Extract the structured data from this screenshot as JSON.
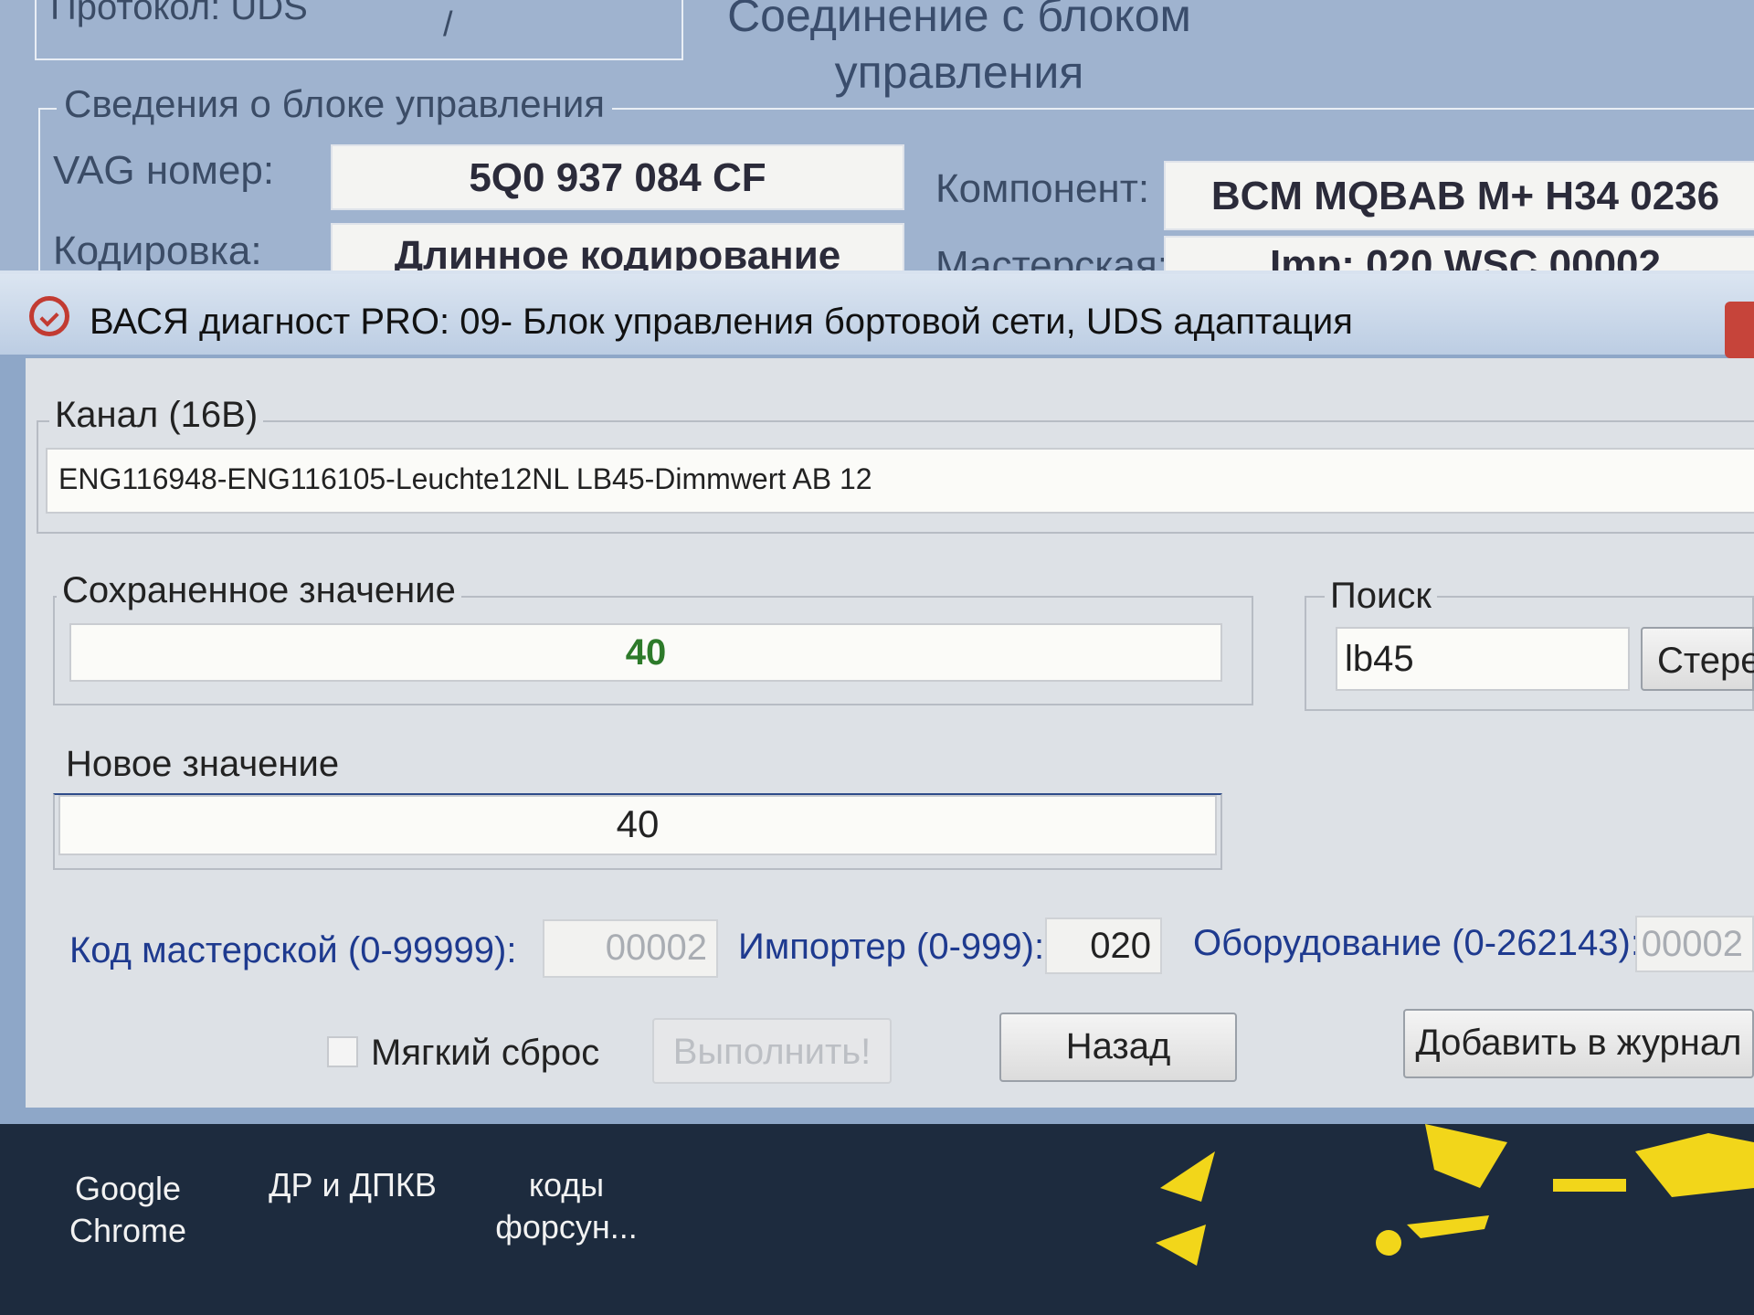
{
  "background_window": {
    "protocol": "Протокол: UDS",
    "slash": "/",
    "connection_title": "Соединение с блоком управления",
    "group_title": "Сведения о блоке управления",
    "vag_label": "VAG номер:",
    "vag_value": "5Q0 937 084 CF",
    "component_label": "Компонент:",
    "component_value": "BCM MQBAB M+  H34 0236",
    "coding_label": "Кодировка:",
    "coding_value": "Длинное кодирование",
    "workshop_label": "Мастерская:",
    "workshop_value": "Imp: 020     WSC 00002"
  },
  "dialog": {
    "title": "ВАСЯ диагност PRO: 09- Блок управления бортовой сети,  UDS адаптация",
    "channel": {
      "group_title": "Канал (16В)",
      "value": "ENG116948-ENG116105-Leuchte12NL LB45-Dimmwert AB 12"
    },
    "saved": {
      "group_title": "Сохраненное значение",
      "value": "40"
    },
    "search": {
      "group_title": "Поиск",
      "value": "lb45",
      "clear_button": "Стере"
    },
    "new_value": {
      "group_title": "Новое значение",
      "value": "40"
    },
    "workshop_code_label": "Код мастерской (0-99999):",
    "workshop_code_value": "00002",
    "importer_label": "Импортер (0-999):",
    "importer_value": "020",
    "equipment_label": "Оборудование (0-262143):",
    "equipment_value": "00002",
    "soft_reset_label": "Мягкий сброс",
    "execute_button": "Выполнить!",
    "back_button": "Назад",
    "log_button": "Добавить в журнал"
  },
  "desktop": {
    "icons": [
      {
        "label": "Google Chrome"
      },
      {
        "label": "ДР и ДПКВ"
      },
      {
        "label": "коды форсун..."
      }
    ]
  },
  "colors": {
    "accent_green": "#2d7a2a",
    "label_blue": "#1e3a8f",
    "close_red": "#c6443a"
  }
}
